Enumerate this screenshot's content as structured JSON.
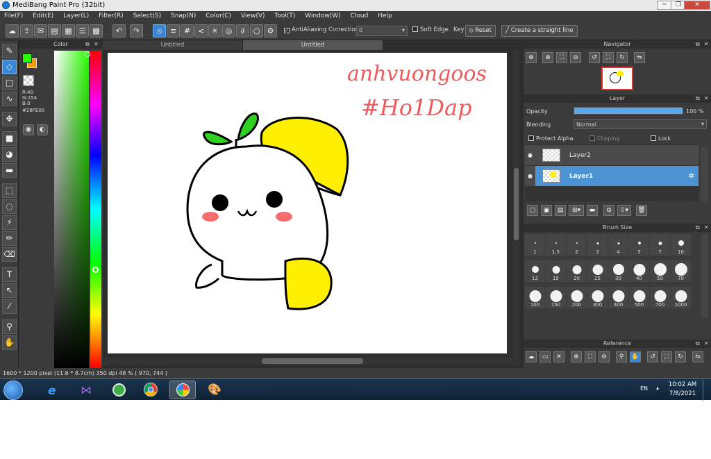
{
  "window": {
    "title": "MediBang Paint Pro (32bit)"
  },
  "menu": [
    "File(F)",
    "Edit(E)",
    "Layer(L)",
    "Filter(R)",
    "Select(S)",
    "Snap(N)",
    "Color(C)",
    "View(V)",
    "Tool(T)",
    "Window(W)",
    "Cloud",
    "Help"
  ],
  "toolbar": {
    "antialiasing": "AntiAliasing",
    "correction_label": "Correction",
    "correction_value": "0",
    "soft_edge": "Soft Edge",
    "key": "Key",
    "reset": "Reset",
    "create_line": "Create a straight line"
  },
  "color_panel": {
    "title": "Color",
    "r": "R:40",
    "g": "G:254",
    "b": "B:0",
    "hex": "#28FE00",
    "fg_color": "#28fe00",
    "bg_color": "#f0a000"
  },
  "tabs": [
    "Untitled",
    "Untitled"
  ],
  "navigator": {
    "title": "Navigator"
  },
  "layer_panel": {
    "title": "Layer",
    "opacity_label": "Opacity",
    "opacity_value": "100 %",
    "opacity_fraction": 1.0,
    "blending_label": "Blending",
    "blending_value": "Normal",
    "protect_alpha": "Protect Alpha",
    "clipping": "Clipping",
    "lock": "Lock",
    "layers": [
      {
        "name": "Layer2",
        "selected": false
      },
      {
        "name": "Layer1",
        "selected": true
      }
    ]
  },
  "brush_size": {
    "title": "Brush Size",
    "sizes": [
      "1",
      "1.5",
      "2",
      "3",
      "4",
      "5",
      "7",
      "10",
      "12",
      "15",
      "20",
      "25",
      "30",
      "40",
      "50",
      "70",
      "100",
      "150",
      "200",
      "300",
      "400",
      "500",
      "700",
      "1000"
    ]
  },
  "reference": {
    "title": "Reference"
  },
  "status": {
    "size": "1600 * 1200 pixel",
    "physical": "(11.6 * 8.7cm)",
    "dpi": "350 dpi",
    "zoom": "48 %",
    "coords": "( 970, 744 )"
  },
  "taskbar": {
    "lang": "EN",
    "time": "10:02 AM",
    "date": "7/8/2021"
  },
  "canvas_text": {
    "line1": "anhvuongoos",
    "line2": "#Ho1Dap"
  }
}
